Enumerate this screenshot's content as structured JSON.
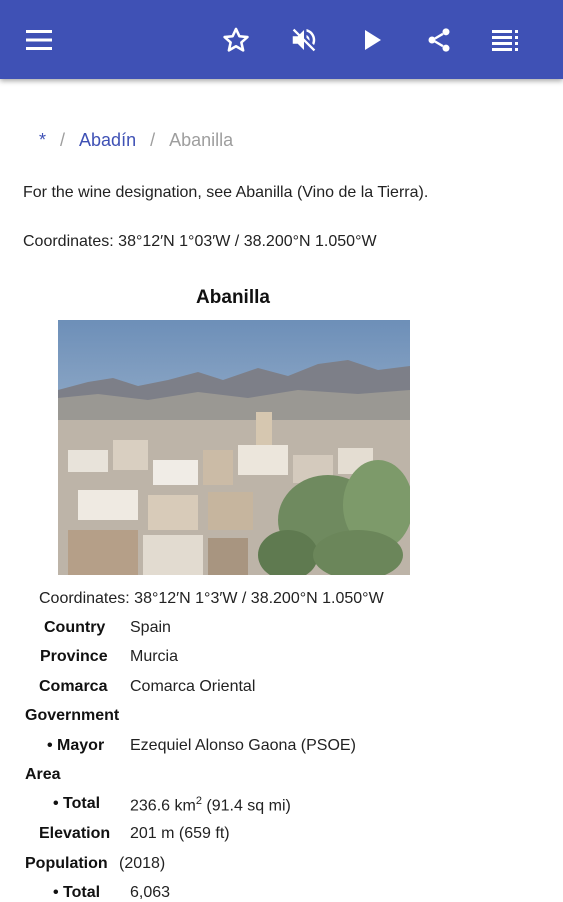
{
  "toolbar": {
    "menu_icon": "menu-icon",
    "favorite_icon": "star-outline-icon",
    "mute_icon": "volume-off-icon",
    "play_icon": "play-icon",
    "share_icon": "share-icon",
    "contents_icon": "list-icon",
    "color": "#3f51b5"
  },
  "breadcrumb": {
    "home": "*",
    "separator": "/",
    "parent": "Abadín",
    "current": "Abanilla"
  },
  "article": {
    "hatnote": "For the wine designation, see Abanilla (Vino de la Tierra).",
    "coordinates": "Coordinates: 38°12′N 1°03′W / 38.200°N 1.050°W"
  },
  "infobox": {
    "title": "Abanilla",
    "coordinates": "Coordinates: 38°12′N 1°3′W / 38.200°N 1.050°W",
    "country_label": "Country",
    "country_value": "Spain",
    "province_label": "Province",
    "province_value": "Murcia",
    "comarca_label": "Comarca",
    "comarca_value": "Comarca Oriental",
    "government_label": "Government",
    "mayor_label": "• Mayor",
    "mayor_value": "Ezequiel Alonso Gaona (PSOE)",
    "area_label": "Area",
    "area_total_label": "• Total",
    "area_total_value": "236.6 km",
    "area_total_sup": "2",
    "area_total_extra": " (91.4 sq mi)",
    "elevation_label": "Elevation",
    "elevation_value": "201 m (659 ft)",
    "population_label": "Population",
    "population_year": "(2018)",
    "pop_total_label": "• Total",
    "pop_total_value": "6,063"
  }
}
